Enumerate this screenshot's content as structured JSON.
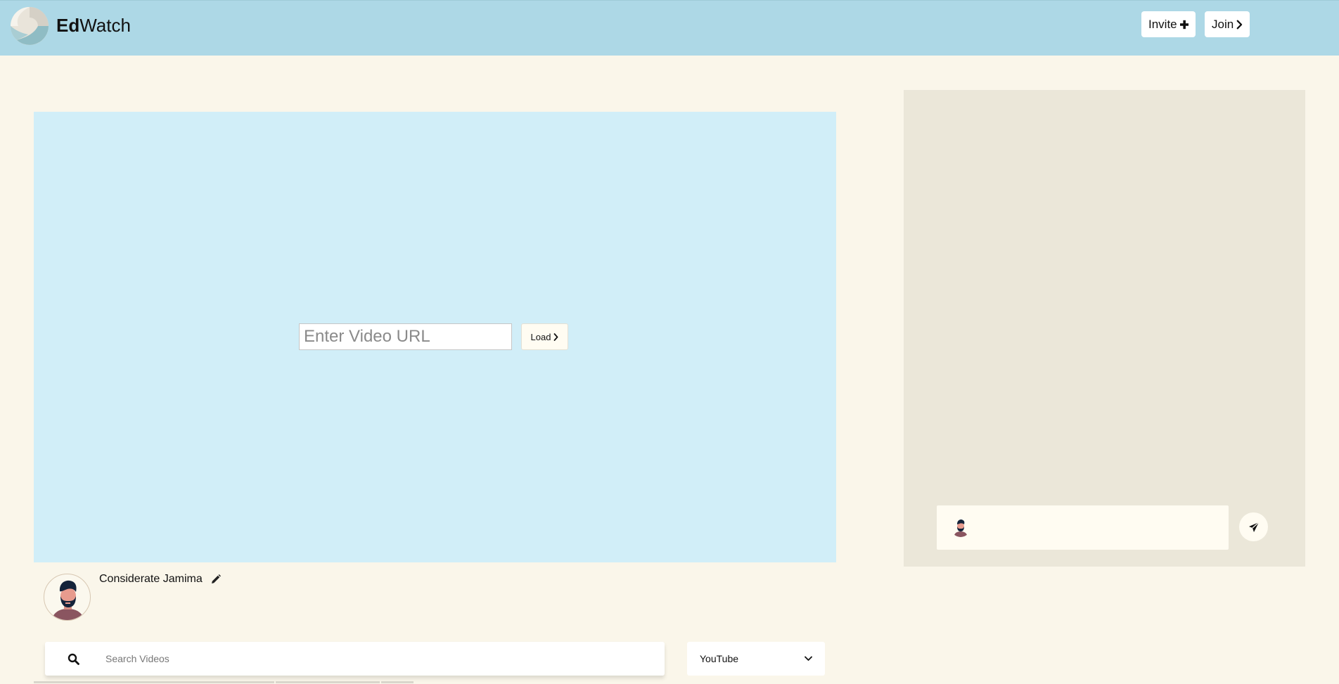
{
  "header": {
    "brand_bold": "Ed",
    "brand_rest": "Watch",
    "invite_label": "Invite",
    "join_label": "Join",
    "background": "#add8e6"
  },
  "player": {
    "url_placeholder": "Enter Video URL",
    "url_value": "",
    "load_label": "Load",
    "background": "#d1eef8"
  },
  "user": {
    "name": "Considerate Jamima",
    "avatar_icon": "bearded-man-avatar-icon",
    "edit_icon": "pencil-icon"
  },
  "search": {
    "placeholder": "Search Videos",
    "value": "",
    "icon": "search-icon",
    "source_selected": "YouTube"
  },
  "chat": {
    "input_value": "",
    "send_icon": "paper-plane-icon",
    "background": "#ebe7d9"
  },
  "colors": {
    "page_background": "#faf6ea",
    "button_background": "#ffffff"
  }
}
